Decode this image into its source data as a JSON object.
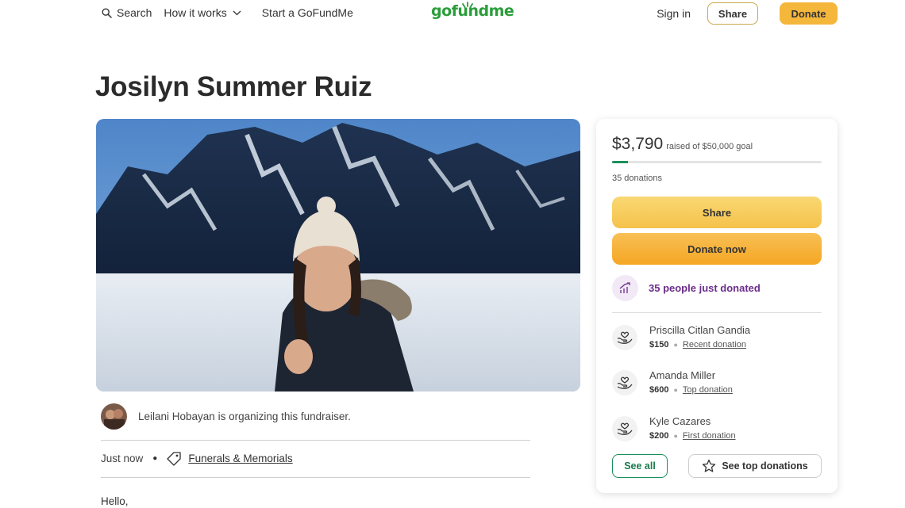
{
  "nav": {
    "search_label": "Search",
    "how_label": "How it works",
    "start_label": "Start a GoFundMe",
    "logo_text": "gofundme",
    "signin_label": "Sign in",
    "share_label": "Share",
    "donate_label": "Donate"
  },
  "page": {
    "title": "Josilyn Summer Ruiz"
  },
  "organizer": {
    "text": "Leilani Hobayan is organizing this fundraiser.",
    "time": "Just now",
    "category": "Funerals & Memorials",
    "story_start": "Hello,"
  },
  "card": {
    "amount": "$3,790",
    "goal_text": "raised of $50,000 goal",
    "progress_fraction": 0.0758,
    "donations": "35 donations",
    "share_label": "Share",
    "donate_label": "Donate now",
    "just_donated": "35 people just donated",
    "donors": [
      {
        "name": "Priscilla Citlan Gandia",
        "amount": "$150",
        "tag": "Recent donation"
      },
      {
        "name": "Amanda Miller",
        "amount": "$600",
        "tag": "Top donation"
      },
      {
        "name": "Kyle Cazares",
        "amount": "$200",
        "tag": "First donation"
      }
    ],
    "see_all_label": "See all",
    "see_top_label": "See top donations"
  },
  "colors": {
    "brand_green": "#2a9d3a",
    "donate_orange": "#f5a623",
    "share_yellow": "#f5c24b",
    "progress_green": "#1a8f5a",
    "just_donated_purple": "#6b2d8b"
  },
  "icons": [
    "search-icon",
    "chevron-down-icon",
    "tag-icon",
    "trend-up-icon",
    "hands-heart-icon",
    "star-icon"
  ]
}
